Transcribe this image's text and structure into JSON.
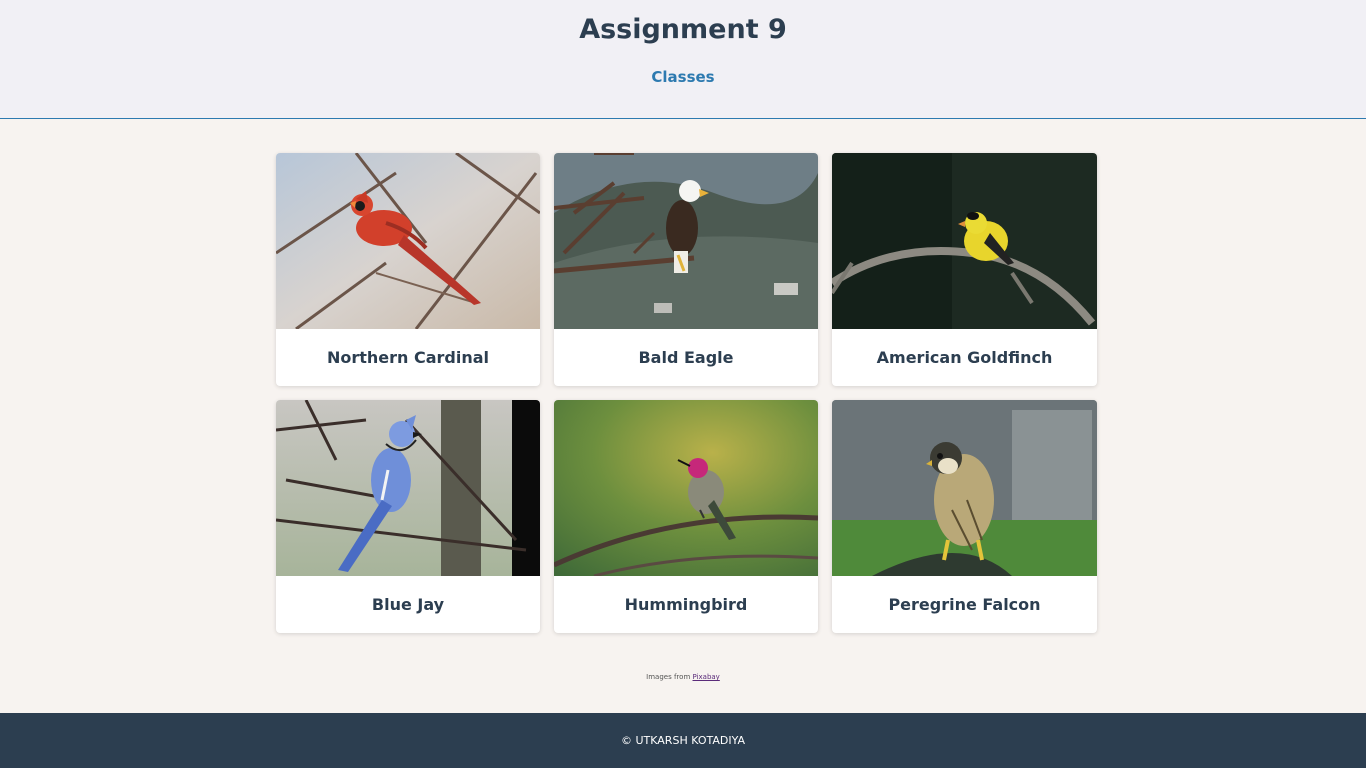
{
  "header": {
    "title": "Assignment 9",
    "nav_link": "Classes"
  },
  "birds": [
    {
      "name": "Northern Cardinal",
      "image": "northern-cardinal-photo"
    },
    {
      "name": "Bald Eagle",
      "image": "bald-eagle-photo"
    },
    {
      "name": "American Goldfinch",
      "image": "american-goldfinch-photo"
    },
    {
      "name": "Blue Jay",
      "image": "blue-jay-photo"
    },
    {
      "name": "Hummingbird",
      "image": "hummingbird-photo"
    },
    {
      "name": "Peregrine Falcon",
      "image": "peregrine-falcon-photo"
    }
  ],
  "credit": {
    "prefix": "Images from",
    "link": "Pixabay"
  },
  "footer": {
    "text": "© UTKARSH KOTADIYA"
  },
  "colors": {
    "header_bg": "#f1f0f5",
    "page_bg": "#f7f3f0",
    "accent": "#2d7ab0",
    "text": "#2c3e50",
    "footer_bg": "#2c3e50"
  }
}
